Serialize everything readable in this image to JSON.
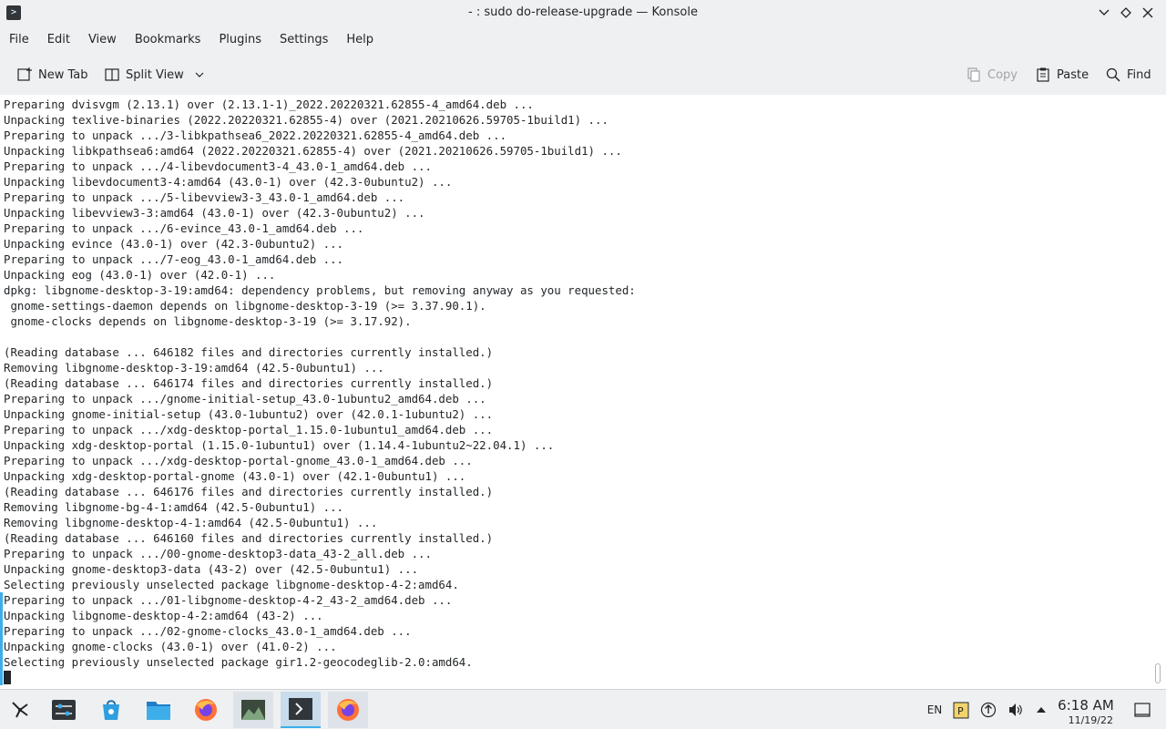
{
  "window": {
    "title": "- : sudo do-release-upgrade — Konsole",
    "app_icon": "terminal-icon"
  },
  "menu": [
    "File",
    "Edit",
    "View",
    "Bookmarks",
    "Plugins",
    "Settings",
    "Help"
  ],
  "toolbar": {
    "new_tab": "New Tab",
    "split_view": "Split View",
    "copy": "Copy",
    "paste": "Paste",
    "find": "Find"
  },
  "terminal": {
    "lines": [
      "Preparing dvisvgm (2.13.1) over (2.13.1-1)_2022.20220321.62855-4_amd64.deb ...",
      "Unpacking texlive-binaries (2022.20220321.62855-4) over (2021.20210626.59705-1build1) ...",
      "Preparing to unpack .../3-libkpathsea6_2022.20220321.62855-4_amd64.deb ...",
      "Unpacking libkpathsea6:amd64 (2022.20220321.62855-4) over (2021.20210626.59705-1build1) ...",
      "Preparing to unpack .../4-libevdocument3-4_43.0-1_amd64.deb ...",
      "Unpacking libevdocument3-4:amd64 (43.0-1) over (42.3-0ubuntu2) ...",
      "Preparing to unpack .../5-libevview3-3_43.0-1_amd64.deb ...",
      "Unpacking libevview3-3:amd64 (43.0-1) over (42.3-0ubuntu2) ...",
      "Preparing to unpack .../6-evince_43.0-1_amd64.deb ...",
      "Unpacking evince (43.0-1) over (42.3-0ubuntu2) ...",
      "Preparing to unpack .../7-eog_43.0-1_amd64.deb ...",
      "Unpacking eog (43.0-1) over (42.0-1) ...",
      "dpkg: libgnome-desktop-3-19:amd64: dependency problems, but removing anyway as you requested:",
      " gnome-settings-daemon depends on libgnome-desktop-3-19 (>= 3.37.90.1).",
      " gnome-clocks depends on libgnome-desktop-3-19 (>= 3.17.92).",
      "",
      "(Reading database ... 646182 files and directories currently installed.)",
      "Removing libgnome-desktop-3-19:amd64 (42.5-0ubuntu1) ...",
      "(Reading database ... 646174 files and directories currently installed.)",
      "Preparing to unpack .../gnome-initial-setup_43.0-1ubuntu2_amd64.deb ...",
      "Unpacking gnome-initial-setup (43.0-1ubuntu2) over (42.0.1-1ubuntu2) ...",
      "Preparing to unpack .../xdg-desktop-portal_1.15.0-1ubuntu1_amd64.deb ...",
      "Unpacking xdg-desktop-portal (1.15.0-1ubuntu1) over (1.14.4-1ubuntu2~22.04.1) ...",
      "Preparing to unpack .../xdg-desktop-portal-gnome_43.0-1_amd64.deb ...",
      "Unpacking xdg-desktop-portal-gnome (43.0-1) over (42.1-0ubuntu1) ...",
      "(Reading database ... 646176 files and directories currently installed.)",
      "Removing libgnome-bg-4-1:amd64 (42.5-0ubuntu1) ...",
      "Removing libgnome-desktop-4-1:amd64 (42.5-0ubuntu1) ...",
      "(Reading database ... 646160 files and directories currently installed.)",
      "Preparing to unpack .../00-gnome-desktop3-data_43-2_all.deb ...",
      "Unpacking gnome-desktop3-data (43-2) over (42.5-0ubuntu1) ...",
      "Selecting previously unselected package libgnome-desktop-4-2:amd64.",
      "Preparing to unpack .../01-libgnome-desktop-4-2_43-2_amd64.deb ...",
      "Unpacking libgnome-desktop-4-2:amd64 (43-2) ...",
      "Preparing to unpack .../02-gnome-clocks_43.0-1_amd64.deb ...",
      "Unpacking gnome-clocks (43.0-1) over (41.0-2) ...",
      "Selecting previously unselected package gir1.2-geocodeglib-2.0:amd64."
    ]
  },
  "taskbar": {
    "items": [
      {
        "name": "app-launcher-icon"
      },
      {
        "name": "system-settings-icon"
      },
      {
        "name": "discover-store-icon"
      },
      {
        "name": "file-manager-icon"
      },
      {
        "name": "firefox-icon"
      },
      {
        "name": "image-viewer-icon"
      },
      {
        "name": "konsole-icon"
      },
      {
        "name": "firefox-window-icon"
      }
    ],
    "tray": {
      "keyboard_layout": "EN",
      "clock_time": "6:18 AM",
      "clock_date": "11/19/22"
    }
  }
}
